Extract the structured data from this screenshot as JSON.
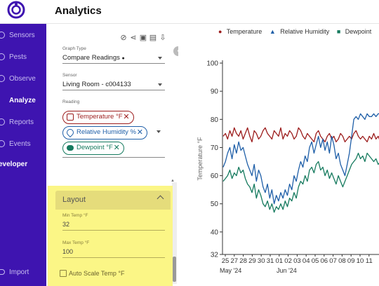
{
  "app": {
    "title": "Analytics"
  },
  "nav": {
    "items": [
      {
        "label": "Sensors",
        "icon": "sensor-icon"
      },
      {
        "label": "Pests",
        "icon": "bug-icon"
      },
      {
        "label": "Observe",
        "icon": "eye-icon"
      },
      {
        "label": "Analyze",
        "icon": "analyze-icon",
        "active": true
      },
      {
        "label": "Reports",
        "icon": "report-icon"
      },
      {
        "label": "Events",
        "icon": "events-icon"
      },
      {
        "label": "eveloper"
      }
    ],
    "import_label": "Import"
  },
  "panel": {
    "graph_type": {
      "label": "Graph Type",
      "value": "Compare Readings"
    },
    "sensor": {
      "label": "Sensor",
      "value": "Living Room - c004133"
    },
    "reading": {
      "label": "Reading",
      "chips": [
        {
          "label": "Temperature °F",
          "color": "#9c1c1c",
          "icon": "thermometer-icon"
        },
        {
          "label": "Relative Humidity %",
          "color": "#1f5fa8",
          "icon": "droplet-icon"
        },
        {
          "label": "Dewpoint °F",
          "color": "#157a5e",
          "icon": "cloud-icon"
        }
      ]
    },
    "layout": {
      "title": "Layout",
      "min_temp": {
        "label": "Min Temp °F",
        "value": "32"
      },
      "max_temp": {
        "label": "Max Temp °F",
        "value": "100"
      },
      "auto_scale_label": "Auto Scale Temp °F"
    }
  },
  "chart_data": {
    "type": "line",
    "title": "",
    "ylabel": "Temperature °F",
    "ylim": [
      32,
      100
    ],
    "yticks": [
      32,
      40,
      50,
      60,
      70,
      80,
      90,
      100
    ],
    "x_tick_labels": [
      "25",
      "27",
      "28",
      "29",
      "30",
      "31",
      "01",
      "02",
      "03",
      "04",
      "05",
      "06",
      "07",
      "08",
      "09",
      "10",
      "11"
    ],
    "month_labels": [
      "May '24",
      "Jun '24"
    ],
    "legend": [
      {
        "name": "Temperature",
        "color": "#9c1c1c",
        "marker": "circle"
      },
      {
        "name": "Relative Humidity",
        "color": "#1f5fa8",
        "marker": "triangle"
      },
      {
        "name": "Dewpoint",
        "color": "#157a5e",
        "marker": "square"
      }
    ],
    "series": [
      {
        "name": "Temperature",
        "color": "#9c1c1c",
        "values": [
          74,
          75,
          73,
          76,
          74,
          77,
          75,
          74,
          76,
          73,
          75,
          77,
          74,
          72,
          76,
          75,
          73,
          74,
          76,
          77,
          75,
          74,
          73,
          76,
          75,
          74,
          77,
          73,
          75,
          74,
          76,
          75,
          73,
          74,
          77,
          76,
          74,
          73,
          75,
          74,
          73,
          72,
          75,
          76,
          74,
          73,
          72,
          74,
          75,
          73,
          74,
          72,
          73,
          75,
          74,
          72,
          73,
          74,
          73,
          75,
          76,
          74,
          73,
          74,
          73,
          72,
          74,
          73,
          75,
          73,
          74,
          72
        ]
      },
      {
        "name": "Relative Humidity",
        "color": "#1f5fa8",
        "values": [
          63,
          65,
          68,
          70,
          66,
          71,
          68,
          72,
          69,
          70,
          67,
          64,
          62,
          60,
          64,
          58,
          62,
          60,
          56,
          54,
          57,
          52,
          55,
          50,
          53,
          51,
          54,
          52,
          55,
          53,
          57,
          55,
          60,
          58,
          62,
          65,
          63,
          67,
          65,
          70,
          72,
          68,
          71,
          74,
          70,
          73,
          69,
          72,
          68,
          74,
          71,
          66,
          68,
          64,
          62,
          60,
          64,
          68,
          74,
          80,
          81,
          80,
          82,
          81,
          80,
          82,
          81,
          81,
          82,
          81,
          82,
          82
        ]
      },
      {
        "name": "Dewpoint",
        "color": "#157a5e",
        "values": [
          58,
          59,
          60,
          62,
          59,
          61,
          60,
          63,
          61,
          62,
          59,
          57,
          56,
          54,
          57,
          52,
          55,
          53,
          50,
          49,
          51,
          48,
          50,
          47,
          49,
          48,
          50,
          48,
          51,
          49,
          52,
          51,
          54,
          52,
          56,
          58,
          57,
          60,
          58,
          62,
          63,
          61,
          64,
          65,
          62,
          63,
          60,
          62,
          59,
          61,
          59,
          57,
          60,
          58,
          56,
          58,
          60,
          62,
          64,
          65,
          66,
          68,
          66,
          67,
          65,
          68,
          67,
          66,
          65,
          66,
          64,
          65
        ]
      }
    ]
  }
}
